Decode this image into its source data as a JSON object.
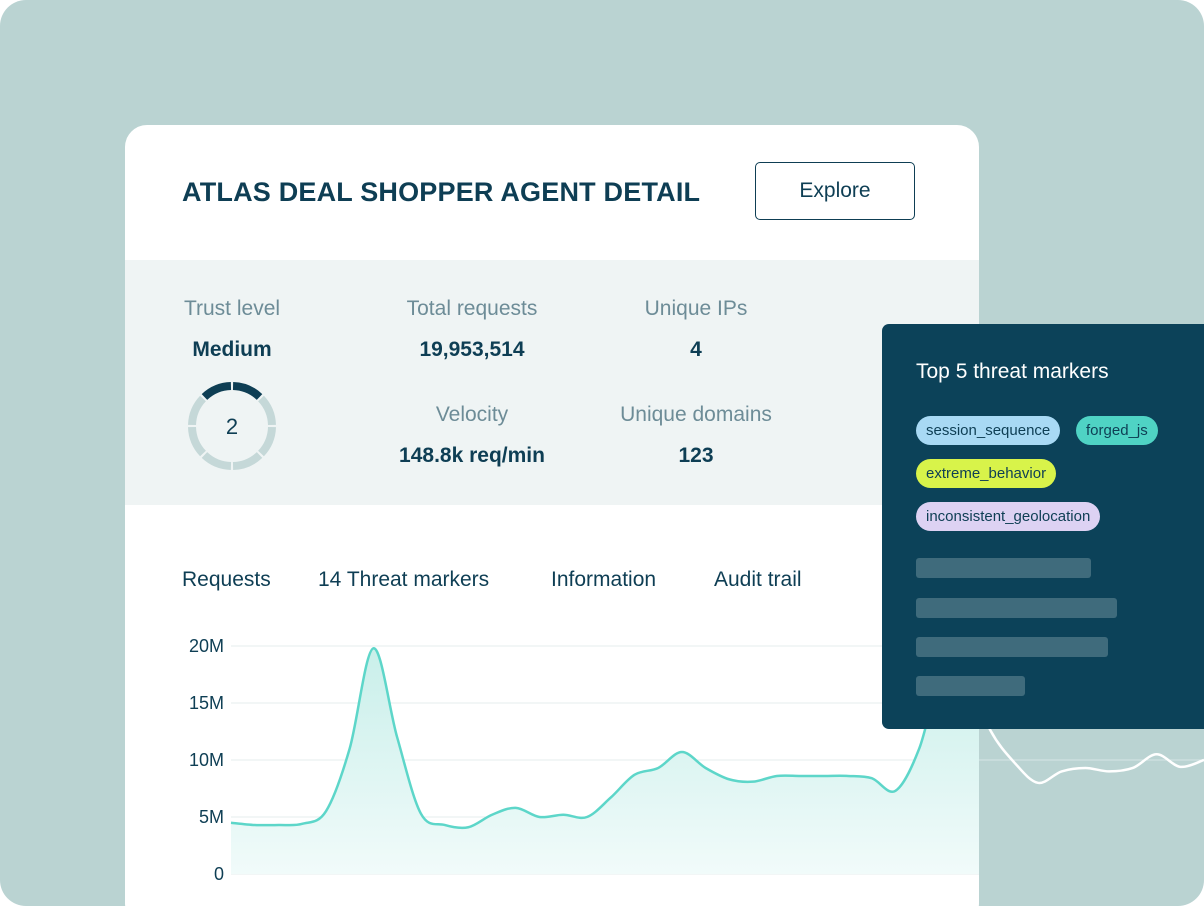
{
  "card": {
    "title": "ATLAS DEAL SHOPPER AGENT DETAIL",
    "explore_label": "Explore"
  },
  "stats": {
    "trust_label": "Trust level",
    "trust_value": "Medium",
    "trust_score": "2",
    "trust_segments_total": 8,
    "trust_segments_filled": 2,
    "total_requests_label": "Total requests",
    "total_requests_value": "19,953,514",
    "unique_ips_label": "Unique IPs",
    "unique_ips_value": "4",
    "velocity_label": "Velocity",
    "velocity_value": "148.8k req/min",
    "unique_domains_label": "Unique domains",
    "unique_domains_value": "123"
  },
  "tabs": [
    {
      "label": "Requests"
    },
    {
      "label": "14 Threat markers"
    },
    {
      "label": "Information"
    },
    {
      "label": "Audit trail"
    }
  ],
  "colors": {
    "background": "#bad3d2",
    "primary": "#0e3e54",
    "accent_line": "#5dd6c9",
    "panel": "#0c4259"
  },
  "threat_panel": {
    "title": "Top 5 threat markers",
    "chips": [
      {
        "label": "session_sequence",
        "color": "#a8d9f4"
      },
      {
        "label": "forged_js",
        "color": "#4fd3c4"
      },
      {
        "label": "extreme_behavior",
        "color": "#d8f34a"
      },
      {
        "label": "inconsistent_geolocation",
        "color": "#ddd2f3"
      }
    ],
    "placeholder_bars": 4
  },
  "chart_data": {
    "type": "area",
    "ylim": [
      0,
      20000000
    ],
    "yticks": [
      "20M",
      "15M",
      "10M",
      "5M",
      "0"
    ],
    "xlabel": "",
    "ylabel": "",
    "series": [
      {
        "values": [
          4.5,
          4.3,
          4.3,
          4.4,
          5.5,
          11,
          19.8,
          12,
          5.3,
          4.3,
          4.1,
          5.2,
          5.8,
          5.0,
          5.2,
          5.0,
          6.7,
          8.7,
          9.3,
          10.7,
          9.3,
          8.3,
          8.1,
          8.6,
          8.6,
          8.6,
          8.6,
          8.4,
          7.3,
          11,
          18,
          17.5,
          12.6,
          9.8,
          8.0,
          9.0,
          9.3,
          9.0,
          9.3,
          10.5,
          9.4,
          10
        ]
      }
    ]
  }
}
